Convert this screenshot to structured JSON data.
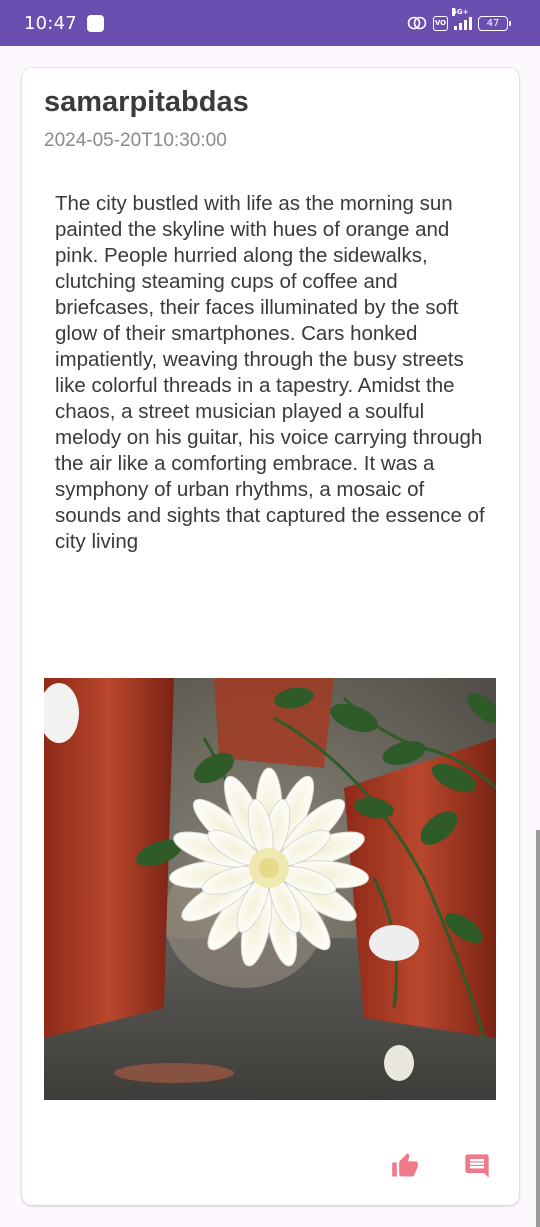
{
  "status_bar": {
    "time": "10:47",
    "network": "5G+",
    "vo_label": "VoLTE",
    "battery": "47",
    "colors": {
      "background": "#6a4fb0"
    }
  },
  "post": {
    "username": "samarpitabdas",
    "timestamp": "2024-05-20T10:30:00",
    "body": "The city bustled with life as the morning sun painted the skyline with hues of orange and pink. People hurried along the sidewalks, clutching steaming cups of coffee and briefcases, their faces illuminated by the soft glow of their smartphones. Cars honked impatiently, weaving through the busy streets like colorful threads in a tapestry. Amidst the chaos, a street musician played a soulful melody on his guitar, his voice carrying through the air like a comforting embrace. It was a symphony of urban rhythms, a mosaic of sounds and sights that captured the essence of city living",
    "image": {
      "description_icon": "photo-white-chrysanthemum"
    },
    "actions": {
      "like_icon": "thumb-up-icon",
      "comment_icon": "comment-icon",
      "accent_color": "#f07a8a"
    }
  }
}
